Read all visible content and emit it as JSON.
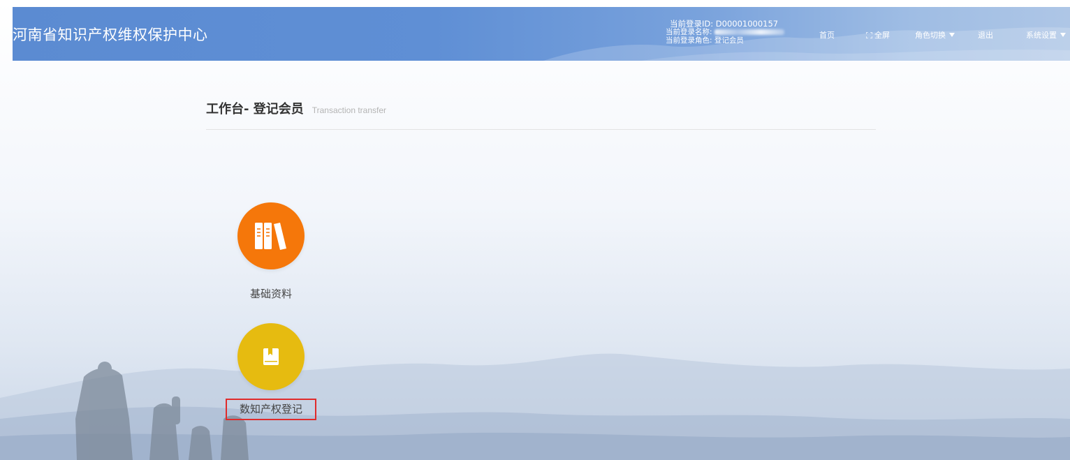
{
  "header": {
    "app_title": "河南省知识产权维权保护中心",
    "user": {
      "id_label": "当前登录ID:",
      "id_value": "D00001000157",
      "name_label": "当前登录名称:",
      "role_label": "当前登录角色:",
      "role_value": "登记会员"
    },
    "nav": {
      "home": "首页",
      "fullscreen": "全屏",
      "role_switch": "角色切换",
      "logout": "退出",
      "system_settings": "系统设置"
    }
  },
  "page": {
    "title": "工作台- 登记会员",
    "subtitle": "Transaction transfer"
  },
  "tiles": [
    {
      "label": "基础资料",
      "icon": "books-icon",
      "color": "#f5770a"
    },
    {
      "label": "数知产权登记",
      "icon": "bookmark-book-icon",
      "color": "#e6bb10",
      "highlighted": true
    }
  ],
  "colors": {
    "header_blue": "#5b8bd2",
    "highlight_border": "#e02b2b"
  }
}
